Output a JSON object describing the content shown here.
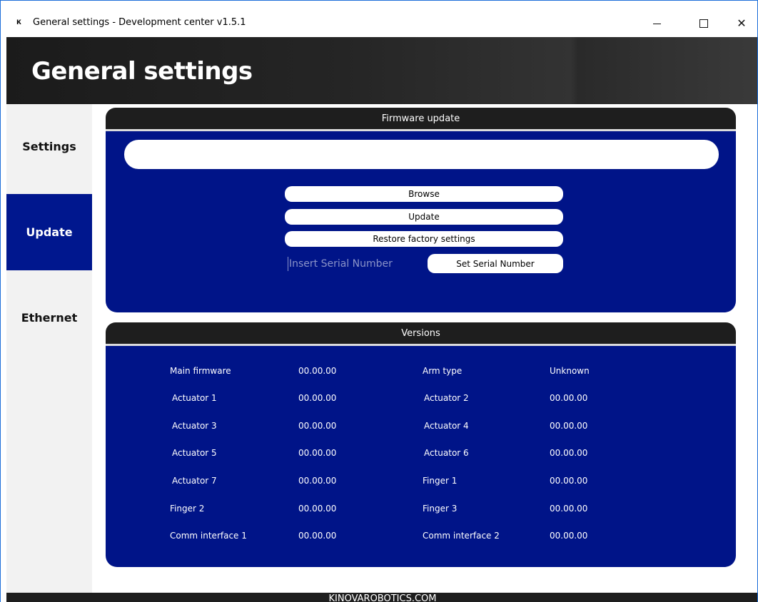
{
  "window": {
    "logo_glyph": "ᴋ",
    "title": "General settings - Development center v1.5.1",
    "minimize_icon": "minimize-icon",
    "maximize_icon": "maximize-icon",
    "close_glyph": "✕"
  },
  "header": {
    "title": "General settings"
  },
  "sidebar": {
    "items": [
      {
        "label": "Settings",
        "active": false
      },
      {
        "label": "Update",
        "active": true
      },
      {
        "label": "Ethernet",
        "active": false
      }
    ]
  },
  "firmware": {
    "heading": "Firmware update",
    "path_value": "",
    "browse_label": "Browse",
    "update_label": "Update",
    "restore_label": "Restore factory settings",
    "serial_placeholder": "Insert Serial Number",
    "serial_value": "",
    "set_serial_label": "Set Serial Number"
  },
  "versions": {
    "heading": "Versions",
    "rows": [
      {
        "left_label": "Main firmware",
        "left_value": "00.00.00",
        "right_label": "Arm type",
        "right_value": "Unknown"
      },
      {
        "left_label": "Actuator 1",
        "left_value": "00.00.00",
        "right_label": "Actuator 2",
        "right_value": "00.00.00"
      },
      {
        "left_label": "Actuator 3",
        "left_value": "00.00.00",
        "right_label": "Actuator 4",
        "right_value": "00.00.00"
      },
      {
        "left_label": "Actuator 5",
        "left_value": "00.00.00",
        "right_label": "Actuator 6",
        "right_value": "00.00.00"
      },
      {
        "left_label": "Actuator 7",
        "left_value": "00.00.00",
        "right_label": "Finger 1",
        "right_value": "00.00.00"
      },
      {
        "left_label": "Finger 2",
        "left_value": "00.00.00",
        "right_label": "Finger 3",
        "right_value": "00.00.00"
      },
      {
        "left_label": "Comm interface 1",
        "left_value": "00.00.00",
        "right_label": "Comm interface 2",
        "right_value": "00.00.00"
      }
    ]
  },
  "footer": {
    "text": "KINOVAROBOTICS.COM"
  },
  "colors": {
    "accent_blue": "#001488",
    "active_tab": "#00178e",
    "dark_header": "#1e1e1e"
  }
}
